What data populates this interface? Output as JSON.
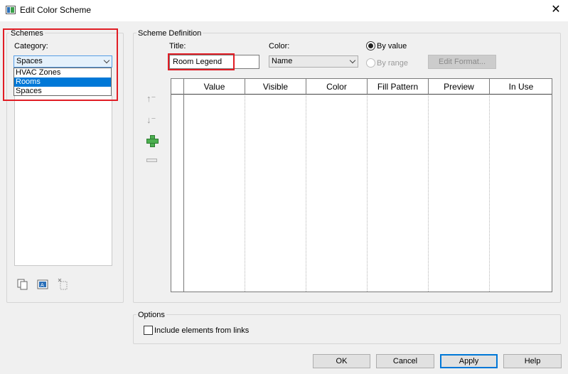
{
  "window": {
    "title": "Edit Color Scheme",
    "close_glyph": "✕"
  },
  "schemes": {
    "group_label": "Schemes",
    "category_label": "Category:",
    "category_value": "Spaces",
    "dropdown_options": [
      {
        "label": "HVAC Zones",
        "selected": false
      },
      {
        "label": "Rooms",
        "selected": true
      },
      {
        "label": "Spaces",
        "selected": false
      }
    ]
  },
  "scheme_definition": {
    "group_label": "Scheme Definition",
    "title_label": "Title:",
    "title_value": "Room Legend",
    "color_label": "Color:",
    "color_value": "Name",
    "by_value_label": "By value",
    "by_range_label": "By range",
    "edit_format_label": "Edit Format...",
    "columns": [
      "Value",
      "Visible",
      "Color",
      "Fill Pattern",
      "Preview",
      "In Use"
    ]
  },
  "options": {
    "group_label": "Options",
    "include_links_label": "Include elements from links",
    "include_links_checked": false
  },
  "buttons": {
    "ok": "OK",
    "cancel": "Cancel",
    "apply": "Apply",
    "help": "Help"
  },
  "icons": {
    "move_up": "arrow-up-icon",
    "move_down": "arrow-down-icon",
    "add": "plus-icon",
    "remove": "minus-icon",
    "duplicate": "duplicate-icon",
    "rename": "rename-icon",
    "delete": "delete-icon"
  },
  "colors": {
    "highlight": "#e11d25",
    "selection": "#0078d7",
    "add_icon": "#4caf50"
  }
}
